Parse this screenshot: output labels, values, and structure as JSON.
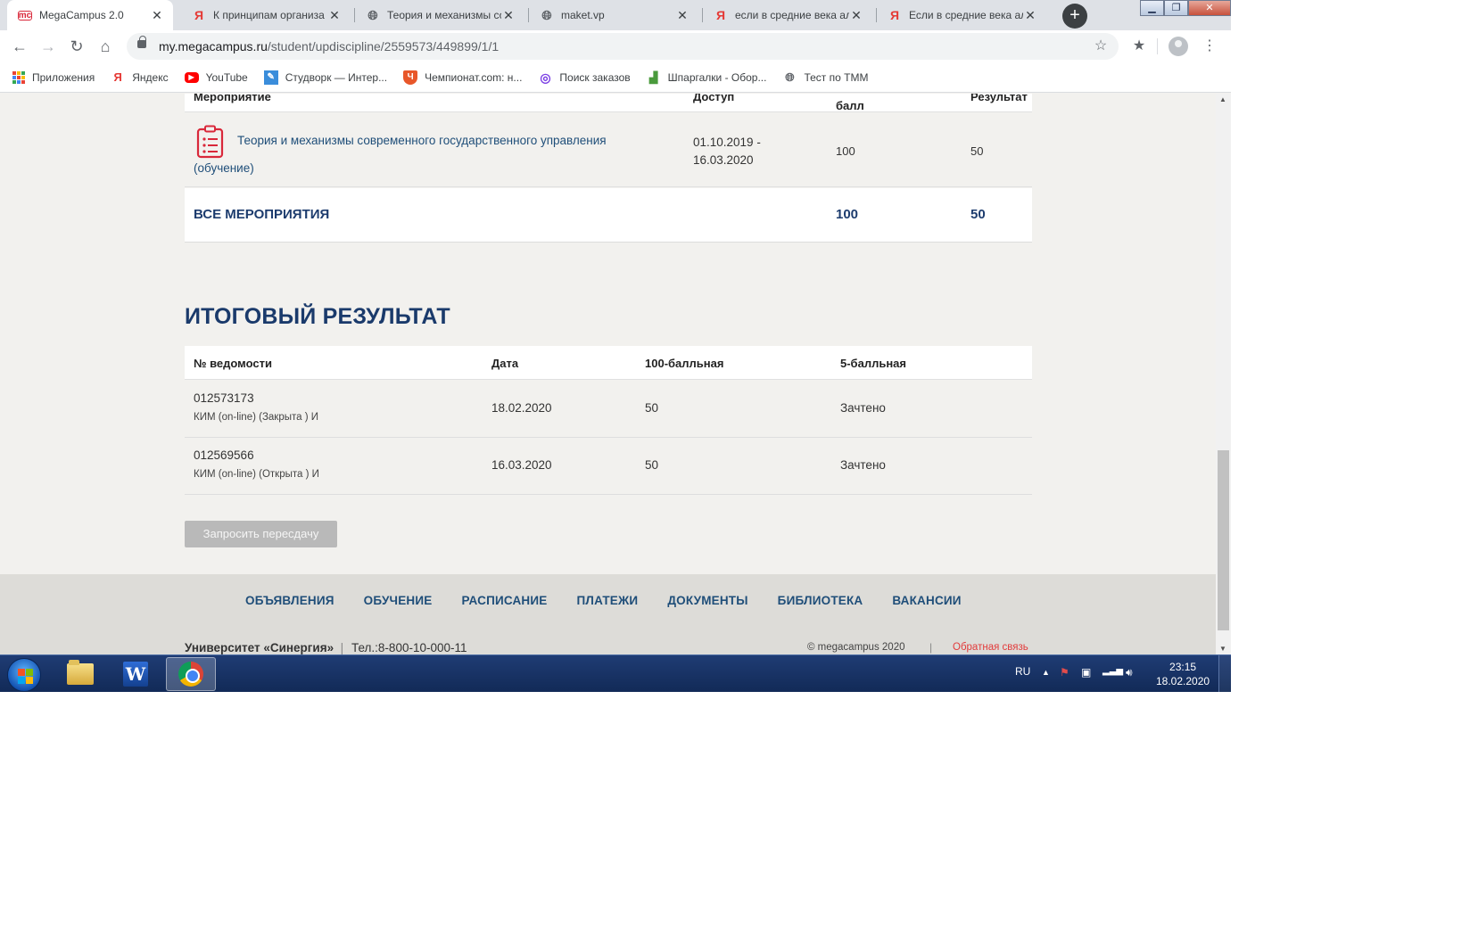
{
  "browser": {
    "tabs": [
      {
        "title": "MegaCampus 2.0",
        "icon": "megacampus-icon",
        "active": true
      },
      {
        "title": "К принципам организа",
        "icon": "yandex-icon"
      },
      {
        "title": "Теория и механизмы со",
        "icon": "globe-icon"
      },
      {
        "title": "maket.vp",
        "icon": "globe-icon"
      },
      {
        "title": "если в средние века ал",
        "icon": "yandex-icon"
      },
      {
        "title": "Если в средние века ал",
        "icon": "yandex-icon"
      }
    ],
    "new_tab": "+",
    "url_host": "my.megacampus.ru",
    "url_path": "/student/updiscipline/2559573/449899/1/1",
    "bookmarks": [
      {
        "label": "Приложения",
        "icon": "apps-icon"
      },
      {
        "label": "Яндекс",
        "icon": "yandex-icon"
      },
      {
        "label": "YouTube",
        "icon": "youtube-icon"
      },
      {
        "label": "Студворк — Интер...",
        "icon": "studwork-icon"
      },
      {
        "label": "Чемпионат.com: н...",
        "icon": "championat-icon"
      },
      {
        "label": "Поиск заказов",
        "icon": "search-orders-icon"
      },
      {
        "label": "Шпаргалки - Обор...",
        "icon": "chart-icon"
      },
      {
        "label": "Тест по ТММ",
        "icon": "globe-icon"
      }
    ]
  },
  "activities": {
    "headers": {
      "event": "Мероприятие",
      "access": "Доступ",
      "max_score": "балл",
      "result": "Результат"
    },
    "rows": [
      {
        "title": "Теория и механизмы современного государственного управления",
        "type": "(обучение)",
        "access_from": "01.10.2019 -",
        "access_to": "16.03.2020",
        "max_score": "100",
        "result": "50"
      }
    ],
    "total": {
      "label": "ВСЕ МЕРОПРИЯТИЯ",
      "max_score": "100",
      "result": "50"
    }
  },
  "final_result": {
    "title": "ИТОГОВЫЙ РЕЗУЛЬТАТ",
    "headers": {
      "sheet": "№ ведомости",
      "date": "Дата",
      "score100": "100-балльная",
      "score5": "5-балльная"
    },
    "rows": [
      {
        "sheet": "012573173",
        "note": "КИМ (on-line) (Закрыта ) И",
        "date": "18.02.2020",
        "score100": "50",
        "score5": "Зачтено"
      },
      {
        "sheet": "012569566",
        "note": "КИМ (on-line) (Открыта ) И",
        "date": "16.03.2020",
        "score100": "50",
        "score5": "Зачтено"
      }
    ],
    "retake_button": "Запросить пересдачу"
  },
  "footer": {
    "nav": [
      "ОБЪЯВЛЕНИЯ",
      "ОБУЧЕНИЕ",
      "РАСПИСАНИЕ",
      "ПЛАТЕЖИ",
      "ДОКУМЕНТЫ",
      "БИБЛИОТЕКА",
      "ВАКАНСИИ"
    ],
    "university": "Университет «Синергия»",
    "separator": "|",
    "phone": "Тел.:8-800-10-000-11",
    "copyright": "© megacampus 2020",
    "feedback": "Обратная связь"
  },
  "taskbar": {
    "language": "RU",
    "time": "23:15",
    "date": "18.02.2020"
  },
  "colors": {
    "brand_blue": "#1a3a6b",
    "link_blue": "#1f4e79",
    "icon_red": "#d9283a",
    "feedback_red": "#e23c3c",
    "page_bg": "#f2f1ee"
  }
}
